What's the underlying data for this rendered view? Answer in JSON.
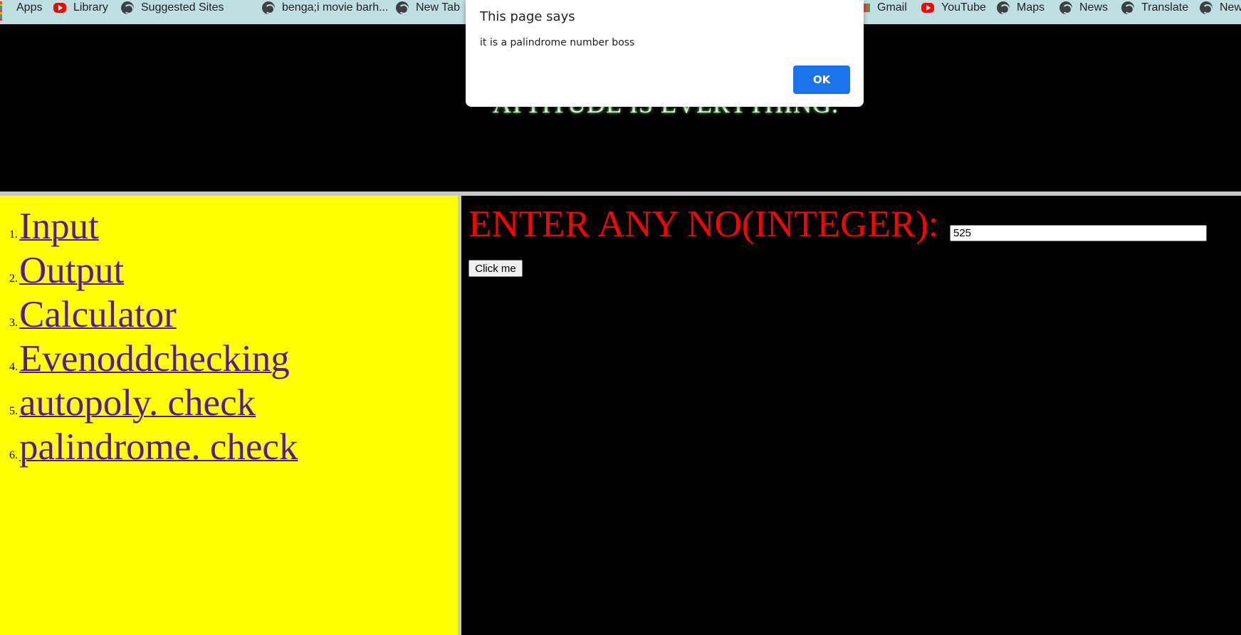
{
  "bookmarks": [
    {
      "label": "Apps",
      "icon": "apps-grid-icon"
    },
    {
      "label": "Library",
      "icon": "youtube-icon"
    },
    {
      "label": "Suggested Sites",
      "icon": "globe-icon"
    },
    {
      "label": "benga;i movie barh...",
      "icon": "globe-icon"
    },
    {
      "label": "New Tab",
      "icon": "globe-icon"
    },
    {
      "label": "Gmail",
      "icon": "gmail-icon"
    },
    {
      "label": "YouTube",
      "icon": "youtube-icon"
    },
    {
      "label": "Maps",
      "icon": "globe-icon"
    },
    {
      "label": "News",
      "icon": "globe-icon"
    },
    {
      "label": "Translate",
      "icon": "globe-icon"
    },
    {
      "label": "New",
      "icon": "globe-icon"
    }
  ],
  "header": {
    "motto": "ATTITUDE IS EVERYTHING."
  },
  "nav": {
    "items": [
      {
        "num": "1.",
        "label": "Input"
      },
      {
        "num": "2.",
        "label": "Output"
      },
      {
        "num": "3.",
        "label": "Calculator"
      },
      {
        "num": "4.",
        "label": "Evenoddchecking"
      },
      {
        "num": "5.",
        "label": "autopoly. check"
      },
      {
        "num": "6.",
        "label": "palindrome. check"
      }
    ]
  },
  "form": {
    "prompt": "ENTER ANY NO(INTEGER):",
    "input_value": "525",
    "button_label": "Click me"
  },
  "dialog": {
    "title": "This page says",
    "message": "it is a palindrome number boss",
    "ok_label": "OK"
  },
  "colors": {
    "bookmarks_bg": "#bfe0e3",
    "nav_bg": "#ffff00",
    "link": "#551a8b",
    "prompt": "#ff0000",
    "ok_button": "#1a73e8"
  }
}
